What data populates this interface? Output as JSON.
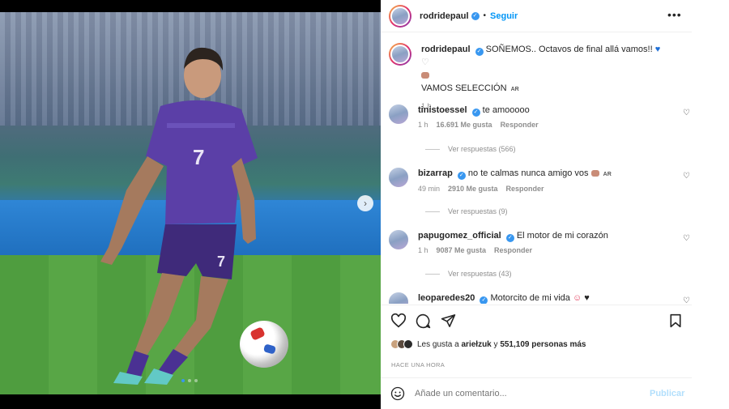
{
  "post": {
    "username": "rodridepaul",
    "follow_label": "Seguir",
    "separator": "•",
    "more_label": "•••",
    "caption_username": "rodridepaul",
    "caption_text": "SOÑEMOS.. Octavos de final allá vamos!!",
    "caption_line2": "VAMOS SELECCIÓN",
    "caption_ar": "AR",
    "caption_time": "1 h",
    "carousel_position": 1,
    "carousel_total": 3
  },
  "comments": [
    {
      "username": "tinistoessel",
      "text": "te amooooo",
      "time": "1 h",
      "likes": "16.691 Me gusta",
      "reply": "Responder",
      "view_replies": "Ver respuestas (566)"
    },
    {
      "username": "bizarrap",
      "text": "no te calmas nunca amigo vos",
      "suffix": "AR",
      "time": "49 min",
      "likes": "2910 Me gusta",
      "reply": "Responder",
      "view_replies": "Ver respuestas (9)"
    },
    {
      "username": "papugomez_official",
      "text": "El motor de mi corazón",
      "time": "1 h",
      "likes": "9087 Me gusta",
      "reply": "Responder",
      "view_replies": "Ver respuestas (43)"
    },
    {
      "username": "leoparedes20",
      "text": "Motorcito de mi vida",
      "suffix_heart": "♥"
    }
  ],
  "actions": {
    "liked_by_prefix": "Les gusta a",
    "liked_by_user": "ariełzuk",
    "liked_by_and": "y",
    "liked_by_count": "551,109 personas más",
    "timestamp": "HACE UNA HORA"
  },
  "add_comment": {
    "placeholder": "Añade un comentario...",
    "publish_label": "Publicar"
  },
  "colors": {
    "accent": "#0095f6",
    "verified": "#3897f0",
    "publish_disabled": "#b2dffc",
    "muted": "#8e8e8e"
  },
  "icons": [
    "verified-badge-icon",
    "more-options-icon",
    "heart-icon",
    "comment-icon",
    "share-icon",
    "bookmark-icon",
    "emoji-icon",
    "next-arrow-icon"
  ]
}
